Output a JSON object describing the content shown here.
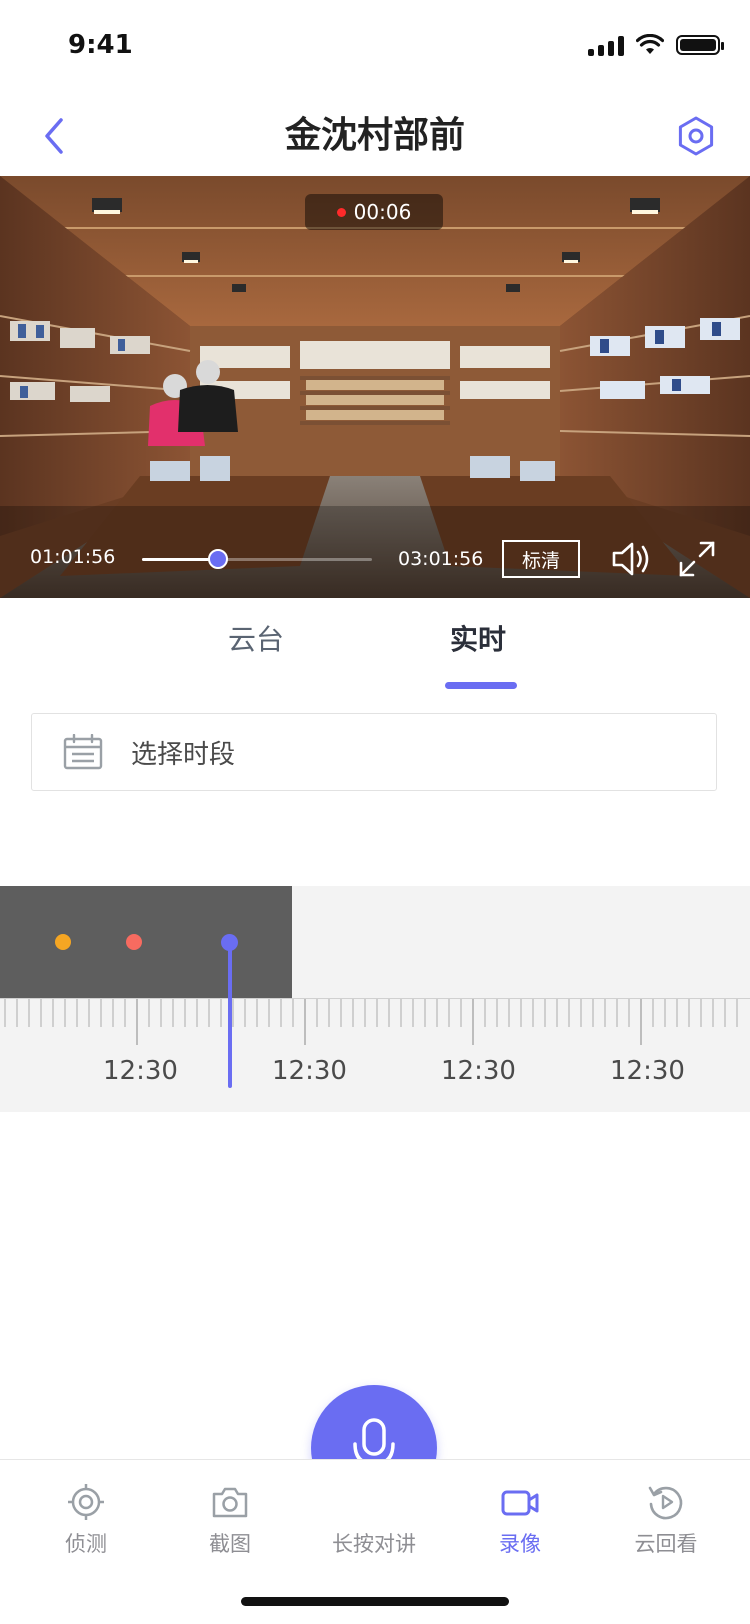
{
  "status_bar": {
    "time": "9:41"
  },
  "header": {
    "title": "金沈村部前"
  },
  "video": {
    "recording_time": "00:06",
    "current_time": "01:01:56",
    "total_time": "03:01:56",
    "progress": 0.33,
    "quality_label": "标清"
  },
  "tabs": [
    {
      "label": "云台",
      "active": false
    },
    {
      "label": "实时",
      "active": true
    }
  ],
  "period_select": {
    "label": "选择时段"
  },
  "timeline": {
    "labels": [
      "12:30",
      "12:30",
      "12:30",
      "12:30"
    ],
    "event_colors": [
      "#f5a623",
      "#f76b60",
      "#6a6df2"
    ],
    "accent_color": "#6a6df2"
  },
  "bottom_nav": {
    "detect": "侦测",
    "screenshot": "截图",
    "talk": "长按对讲",
    "record": "录像",
    "cloud_view": "云回看"
  }
}
